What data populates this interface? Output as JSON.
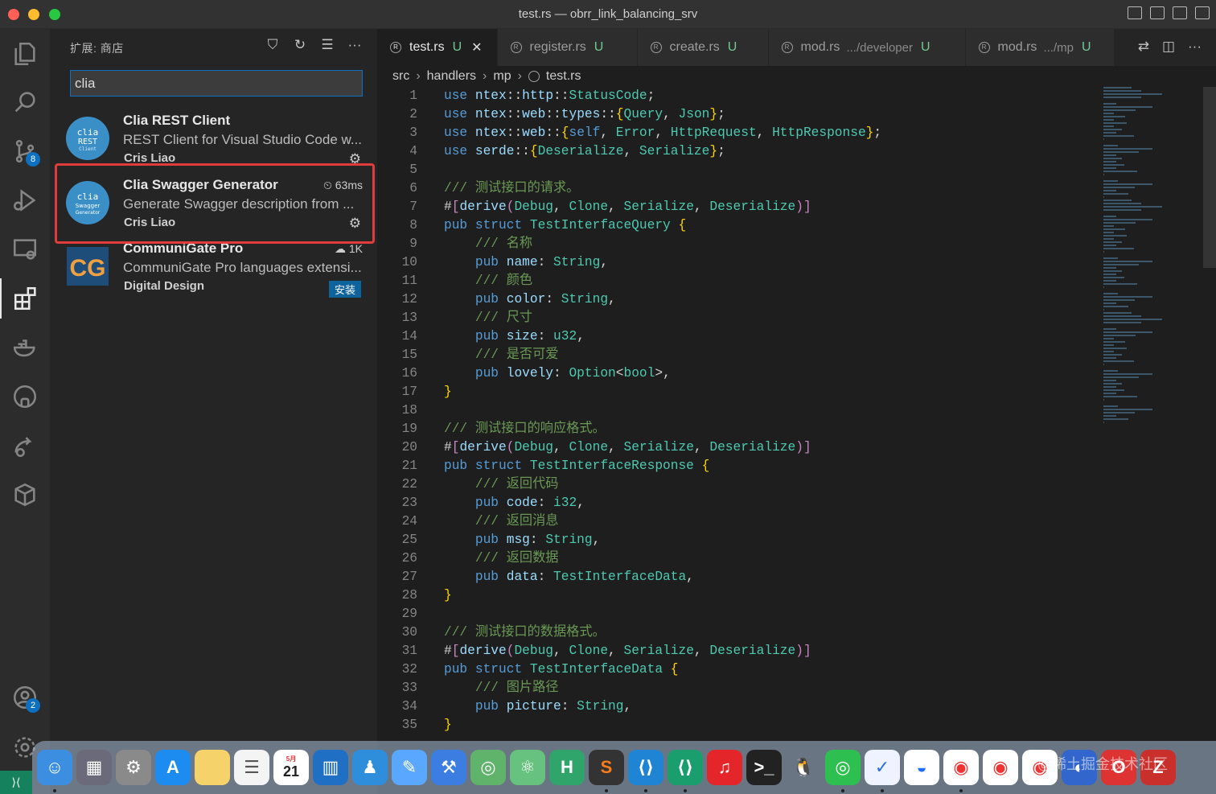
{
  "window": {
    "title": "test.rs — obrr_link_balancing_srv"
  },
  "activity": {
    "scm_badge": "8",
    "accounts_badge": "2"
  },
  "sidebar": {
    "title": "扩展: 商店",
    "search_value": "clia",
    "extensions": [
      {
        "name": "Clia REST Client",
        "description": "REST Client for Visual Studio Code w...",
        "publisher": "Cris Liao",
        "icon_text": "clia",
        "icon_sub": "REST",
        "icon_sub2": "Client"
      },
      {
        "name": "Clia Swagger Generator",
        "description": "Generate Swagger description from ...",
        "publisher": "Cris Liao",
        "meta": "63ms",
        "icon_text": "clia",
        "icon_sub": "Swagger",
        "icon_sub2": "Generator"
      },
      {
        "name": "CommuniGate Pro",
        "description": "CommuniGate Pro languages extensi...",
        "publisher": "Digital Design",
        "meta": "1K",
        "install_label": "安装",
        "icon_text": "CG"
      }
    ]
  },
  "tabs": [
    {
      "label": "test.rs",
      "status": "U",
      "active": true
    },
    {
      "label": "register.rs",
      "status": "U"
    },
    {
      "label": "create.rs",
      "status": "U"
    },
    {
      "label": "mod.rs",
      "dir": ".../developer",
      "status": "U"
    },
    {
      "label": "mod.rs",
      "dir": ".../mp",
      "status": "U"
    }
  ],
  "breadcrumb": [
    "src",
    "handlers",
    "mp",
    "test.rs"
  ],
  "code": [
    "use ntex::http::StatusCode;",
    "use ntex::web::types::{Query, Json};",
    "use ntex::web::{self, Error, HttpRequest, HttpResponse};",
    "use serde::{Deserialize, Serialize};",
    "",
    "/// 测试接口的请求。",
    "#[derive(Debug, Clone, Serialize, Deserialize)]",
    "pub struct TestInterfaceQuery {",
    "    /// 名称",
    "    pub name: String,",
    "    /// 颜色",
    "    pub color: String,",
    "    /// 尺寸",
    "    pub size: u32,",
    "    /// 是否可爱",
    "    pub lovely: Option<bool>,",
    "}",
    "",
    "/// 测试接口的响应格式。",
    "#[derive(Debug, Clone, Serialize, Deserialize)]",
    "pub struct TestInterfaceResponse {",
    "    /// 返回代码",
    "    pub code: i32,",
    "    /// 返回消息",
    "    pub msg: String,",
    "    /// 返回数据",
    "    pub data: TestInterfaceData,",
    "}",
    "",
    "/// 测试接口的数据格式。",
    "#[derive(Debug, Clone, Serialize, Deserialize)]",
    "pub struct TestInterfaceData {",
    "    /// 图片路径",
    "    pub picture: String,",
    "}"
  ],
  "dock": {
    "calendar_month": "5月",
    "calendar_day": "21",
    "watermark": "@稀土掘金技术社区"
  }
}
